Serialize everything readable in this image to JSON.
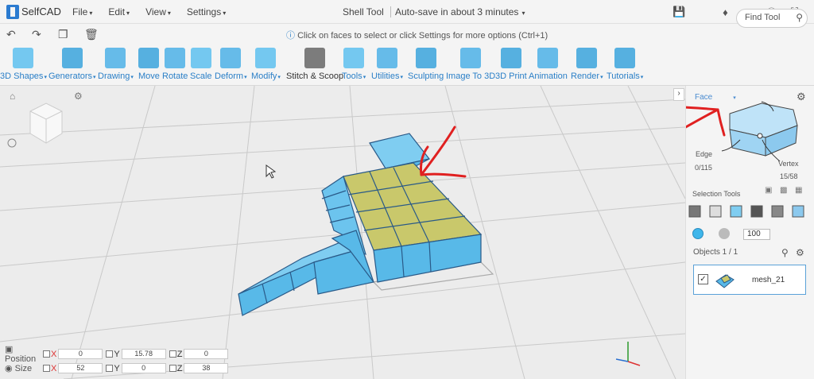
{
  "app": {
    "logo_text": "SelfCAD",
    "title": "Shell Tool",
    "autosave": "Auto-save in about 3 minutes"
  },
  "menu": [
    "File",
    "Edit",
    "View",
    "Settings"
  ],
  "top_icons": [
    "save-icon",
    "share-icon",
    "bell-icon",
    "user-icon",
    "info-icon",
    "fullscreen-icon"
  ],
  "actions": [
    "undo-icon",
    "redo-icon",
    "copy-icon",
    "delete-icon"
  ],
  "hint": "Click on faces to select or click Settings for more options (Ctrl+1)",
  "toolbar": [
    {
      "label": "3D Shapes",
      "dd": true
    },
    {
      "label": "Generators",
      "dd": true
    },
    {
      "label": "Drawing",
      "dd": true
    },
    {
      "label": "Move",
      "dd": false
    },
    {
      "label": "Rotate",
      "dd": false
    },
    {
      "label": "Scale",
      "dd": false
    },
    {
      "label": "Deform",
      "dd": true
    },
    {
      "label": "Modify",
      "dd": true
    },
    {
      "label": "Stitch & Scoop",
      "dd": false
    },
    {
      "label": "Tools",
      "dd": true
    },
    {
      "label": "Utilities",
      "dd": true
    },
    {
      "label": "Sculpting",
      "dd": false
    },
    {
      "label": "Image To 3D",
      "dd": false
    },
    {
      "label": "3D Print",
      "dd": false
    },
    {
      "label": "Animation",
      "dd": false
    },
    {
      "label": "Render",
      "dd": true
    },
    {
      "label": "Tutorials",
      "dd": true
    }
  ],
  "find_tool": "Find Tool",
  "panel": {
    "mode": "Face",
    "edge_label": "Edge",
    "edge_count": "0/115",
    "vertex_label": "Vertex",
    "vertex_count": "15/58",
    "selection_tools": "Selection Tools",
    "percent": "100",
    "objects_title": "Objects 1 / 1",
    "object_name": "mesh_21"
  },
  "transform": {
    "position_label": "Position",
    "size_label": "Size",
    "position": {
      "x": "0",
      "y": "15.78",
      "z": "0"
    },
    "size": {
      "x": "52",
      "y": "0",
      "z": "38"
    }
  },
  "colors": {
    "accent": "#2a7fc7",
    "mesh": "#5dbfef",
    "selected": "#c9c86b",
    "annotation": "#e02020"
  }
}
